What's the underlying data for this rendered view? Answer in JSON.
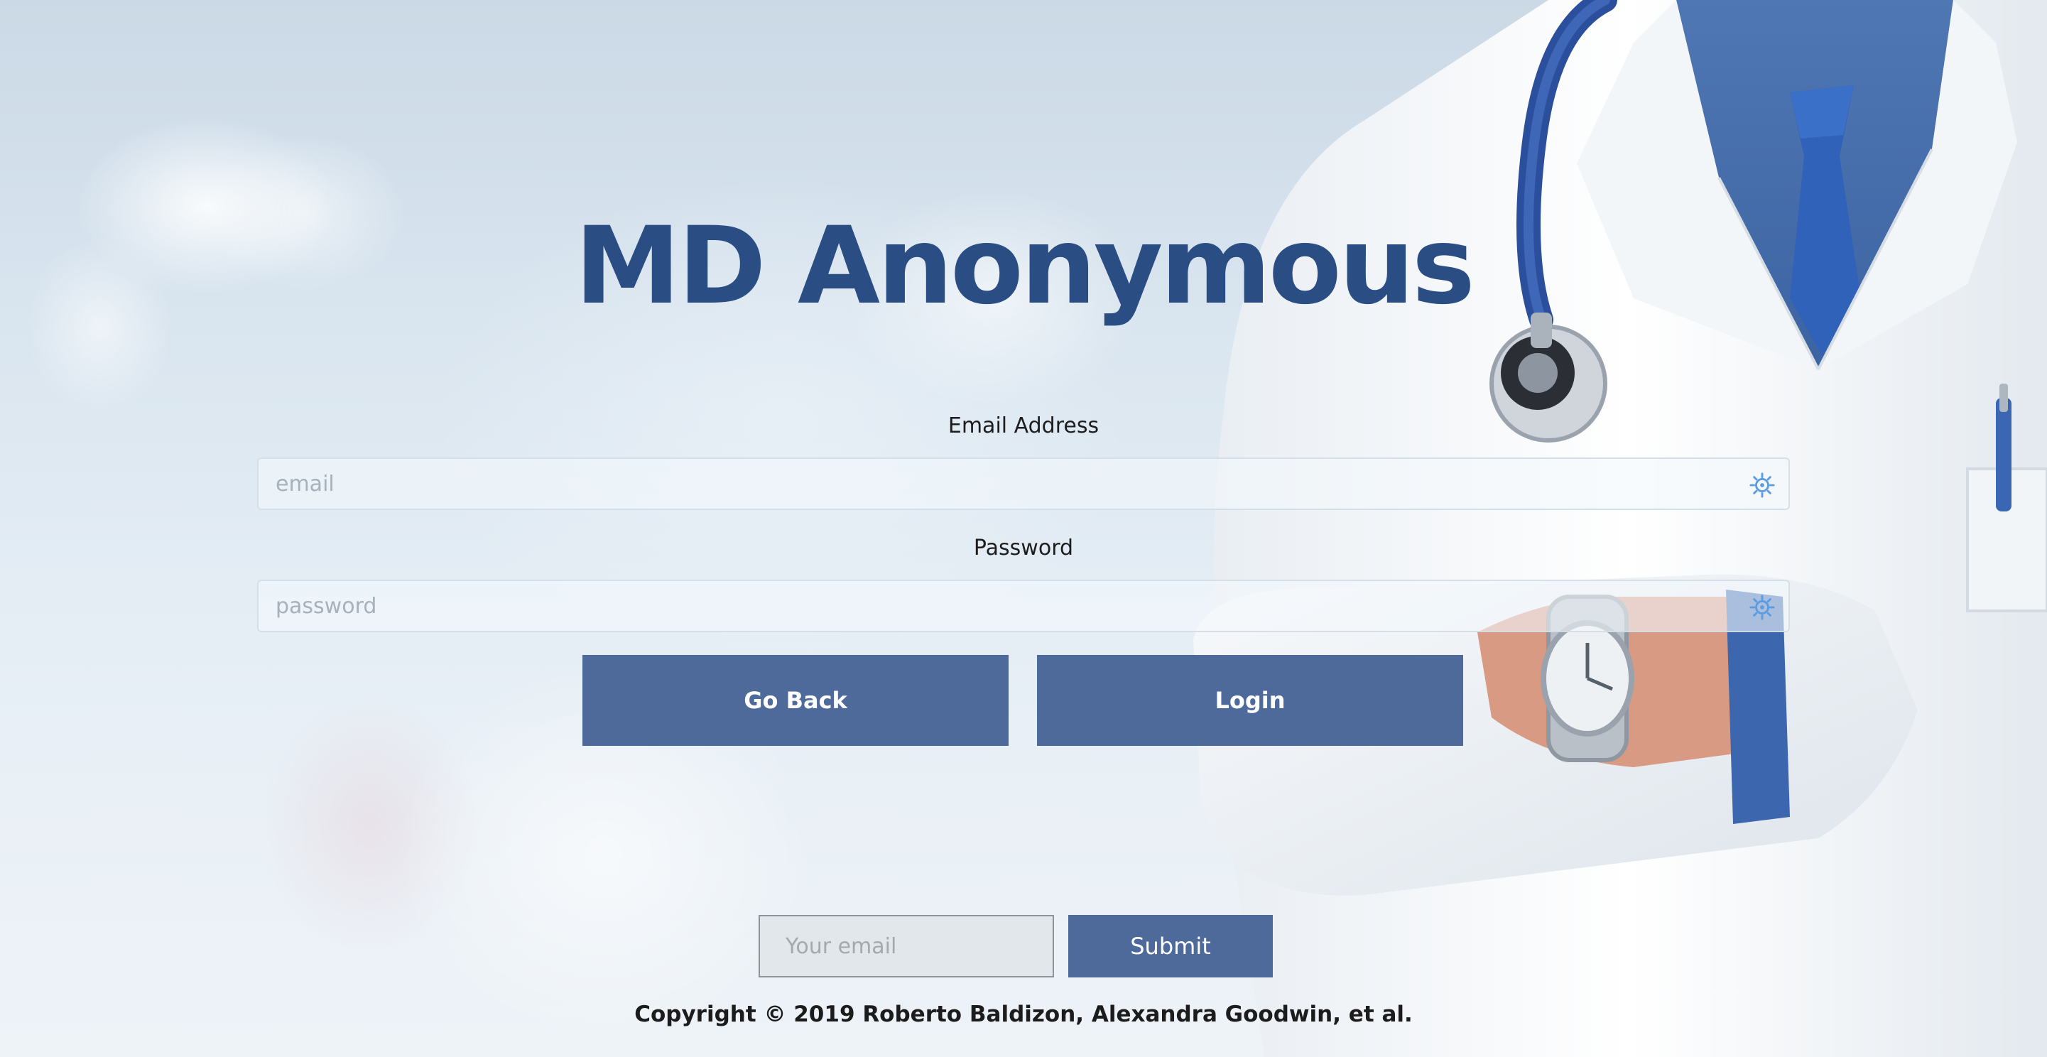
{
  "app": {
    "title": "MD Anonymous"
  },
  "login_form": {
    "email_label": "Email Address",
    "email_placeholder": "email",
    "email_value": "",
    "password_label": "Password",
    "password_placeholder": "password",
    "password_value": "",
    "go_back_label": "Go Back",
    "login_label": "Login",
    "field_icon": "password-manager-key-icon"
  },
  "newsletter": {
    "email_placeholder": "Your email",
    "submit_label": "Submit"
  },
  "footer": {
    "copyright": "Copyright © 2019 Roberto Baldizon, Alexandra Goodwin, et al."
  },
  "colors": {
    "title": "#2a4e84",
    "button": "#4d6a9b",
    "button_text": "#ffffff",
    "background": "#dbe6ef"
  },
  "background_image": "doctor-in-white-coat-with-stethoscope"
}
